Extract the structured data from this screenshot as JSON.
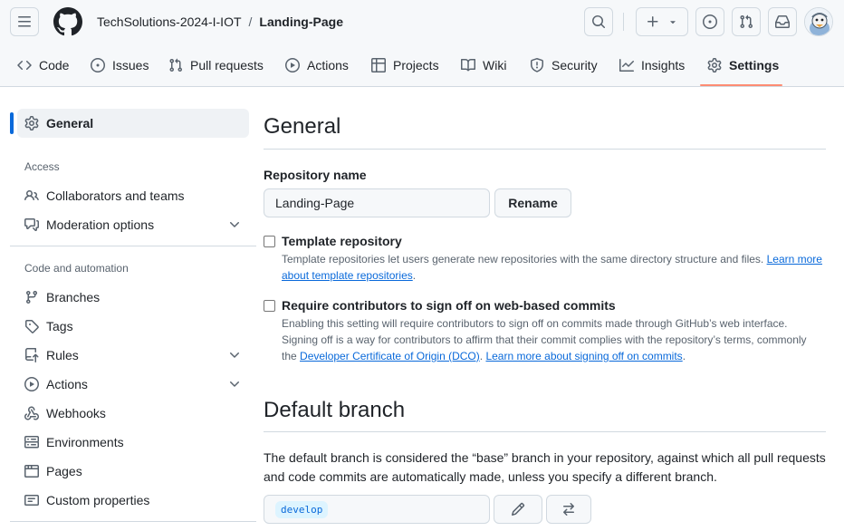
{
  "header": {
    "owner": "TechSolutions-2024-I-IOT",
    "separator": "/",
    "repo": "Landing-Page"
  },
  "repo_nav": [
    {
      "label": "Code",
      "icon": "code-icon"
    },
    {
      "label": "Issues",
      "icon": "issue-opened-icon"
    },
    {
      "label": "Pull requests",
      "icon": "git-pull-request-icon"
    },
    {
      "label": "Actions",
      "icon": "play-icon"
    },
    {
      "label": "Projects",
      "icon": "table-icon"
    },
    {
      "label": "Wiki",
      "icon": "book-icon"
    },
    {
      "label": "Security",
      "icon": "shield-icon"
    },
    {
      "label": "Insights",
      "icon": "graph-icon"
    },
    {
      "label": "Settings",
      "icon": "gear-icon",
      "selected": true
    }
  ],
  "sidebar": {
    "general": "General",
    "access_heading": "Access",
    "access_items": [
      {
        "label": "Collaborators and teams",
        "icon": "people-icon"
      },
      {
        "label": "Moderation options",
        "icon": "comment-discussion-icon",
        "expandable": true
      }
    ],
    "code_heading": "Code and automation",
    "code_items": [
      {
        "label": "Branches",
        "icon": "git-branch-icon"
      },
      {
        "label": "Tags",
        "icon": "tag-icon"
      },
      {
        "label": "Rules",
        "icon": "repo-push-icon",
        "expandable": true
      },
      {
        "label": "Actions",
        "icon": "play-icon",
        "expandable": true
      },
      {
        "label": "Webhooks",
        "icon": "webhook-icon"
      },
      {
        "label": "Environments",
        "icon": "server-icon"
      },
      {
        "label": "Pages",
        "icon": "browser-icon"
      },
      {
        "label": "Custom properties",
        "icon": "note-icon"
      }
    ]
  },
  "main": {
    "title": "General",
    "repo_name_label": "Repository name",
    "repo_name_value": "Landing-Page",
    "rename_label": "Rename",
    "template": {
      "label": "Template repository",
      "desc": "Template repositories let users generate new repositories with the same directory structure and files.",
      "link1": "Learn more",
      "link2": "about template repositories",
      "end": "."
    },
    "signoff": {
      "label": "Require contributors to sign off on web-based commits",
      "desc1": "Enabling this setting will require contributors to sign off on commits made through GitHub’s web interface.",
      "desc2": "Signing off is a way for contributors to affirm that their commit complies with the repository’s terms, commonly",
      "desc3_pre": "the",
      "link_dco": "Developer Certificate of Origin (DCO)",
      "mid": ".",
      "link_more": "Learn more about signing off on commits",
      "end": "."
    },
    "default_branch_title": "Default branch",
    "default_branch_desc": "The default branch is considered the “base” branch in your repository, against which all pull requests and code commits are automatically made, unless you specify a different branch.",
    "default_branch_value": "develop"
  },
  "colors": {
    "accent": "#0969da",
    "underline": "#fd8c73"
  }
}
